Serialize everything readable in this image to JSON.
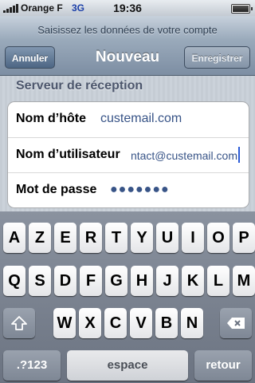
{
  "status_bar": {
    "carrier": "Orange F",
    "network": "3G",
    "time": "19:36"
  },
  "nav": {
    "prompt": "Saisissez les données de votre compte",
    "title": "Nouveau",
    "cancel_label": "Annuler",
    "save_label": "Enregistrer"
  },
  "section": {
    "header": "Serveur de réception",
    "rows": [
      {
        "label": "Nom d’hôte",
        "value": "custemail.com"
      },
      {
        "label": "Nom d’utilisateur",
        "value": "contact@custemail.com"
      },
      {
        "label": "Mot de passe",
        "value": "●●●●●●●"
      }
    ]
  },
  "keyboard": {
    "row1": [
      "A",
      "Z",
      "E",
      "R",
      "T",
      "Y",
      "U",
      "I",
      "O",
      "P"
    ],
    "row2": [
      "Q",
      "S",
      "D",
      "F",
      "G",
      "H",
      "J",
      "K",
      "L",
      "M"
    ],
    "row3": [
      "W",
      "X",
      "C",
      "V",
      "B",
      "N"
    ],
    "numbers_label": ".?123",
    "space_label": "espace",
    "return_label": "retour",
    "shift_icon": "shift-icon",
    "delete_icon": "delete-icon"
  }
}
